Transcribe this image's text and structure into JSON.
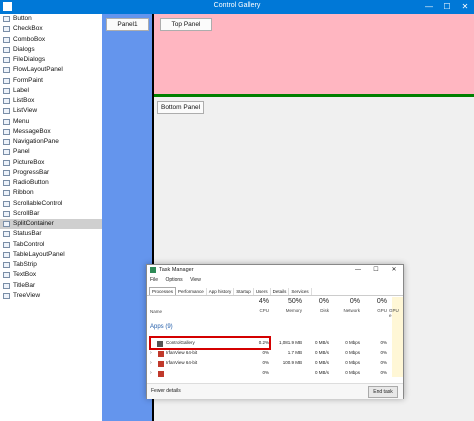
{
  "window": {
    "title": "Control Gallery",
    "minimize": "—",
    "maximize": "☐",
    "close": "✕"
  },
  "sidebar": {
    "items": [
      {
        "label": "Button"
      },
      {
        "label": "CheckBox"
      },
      {
        "label": "ComboBox"
      },
      {
        "label": "Dialogs"
      },
      {
        "label": "FileDialogs"
      },
      {
        "label": "FlowLayoutPanel"
      },
      {
        "label": "FormPaint"
      },
      {
        "label": "Label"
      },
      {
        "label": "ListBox"
      },
      {
        "label": "ListView"
      },
      {
        "label": "Menu"
      },
      {
        "label": "MessageBox"
      },
      {
        "label": "NavigationPane"
      },
      {
        "label": "Panel"
      },
      {
        "label": "PictureBox"
      },
      {
        "label": "ProgressBar"
      },
      {
        "label": "RadioButton"
      },
      {
        "label": "Ribbon"
      },
      {
        "label": "ScrollableControl"
      },
      {
        "label": "ScrollBar"
      },
      {
        "label": "SplitContainer",
        "selected": true
      },
      {
        "label": "StatusBar"
      },
      {
        "label": "TabControl"
      },
      {
        "label": "TableLayoutPanel"
      },
      {
        "label": "TabStrip"
      },
      {
        "label": "TextBox"
      },
      {
        "label": "TitleBar"
      },
      {
        "label": "TreeView"
      }
    ]
  },
  "split": {
    "panel1_button": "Panel1",
    "top_panel_button": "Top Panel",
    "bottom_panel_button": "Bottom Panel",
    "colors": {
      "panel1": "#6495ed",
      "top": "#ffb6c1",
      "divider": "#008000",
      "splitter": "#000000"
    }
  },
  "task_manager": {
    "title": "Task Manager",
    "menu": [
      "File",
      "Options",
      "View"
    ],
    "tabs": [
      "Processes",
      "Performance",
      "App history",
      "Startup",
      "Users",
      "Details",
      "Services"
    ],
    "columns": {
      "name": "Name",
      "cpu": {
        "pct": "4%",
        "label": "CPU"
      },
      "memory": {
        "pct": "50%",
        "label": "Memory"
      },
      "disk": {
        "pct": "0%",
        "label": "Disk"
      },
      "network": {
        "pct": "0%",
        "label": "Network"
      },
      "gpu": {
        "pct": "0%",
        "label": "GPU"
      },
      "gpu_engine": {
        "label": "GPU e"
      }
    },
    "group": "Apps (9)",
    "rows": [
      {
        "name": "ControlGallery",
        "cpu": "0.2%",
        "memory": "1,081.9 MB",
        "disk": "0 MB/s",
        "network": "0 Mbps",
        "gpu": "0%"
      },
      {
        "name": "IrfanView 64-bit",
        "cpu": "0%",
        "memory": "1.7 MB",
        "disk": "0 MB/s",
        "network": "0 Mbps",
        "gpu": "0%"
      },
      {
        "name": "IrfanView 64-bit",
        "cpu": "0%",
        "memory": "100.9 MB",
        "disk": "0 MB/s",
        "network": "0 Mbps",
        "gpu": "0%"
      },
      {
        "name": "",
        "cpu": "0%",
        "memory": "",
        "disk": "0 MB/s",
        "network": "0 Mbps",
        "gpu": "0%"
      }
    ],
    "fewer_details": "Fewer details",
    "end_task": "End task"
  }
}
